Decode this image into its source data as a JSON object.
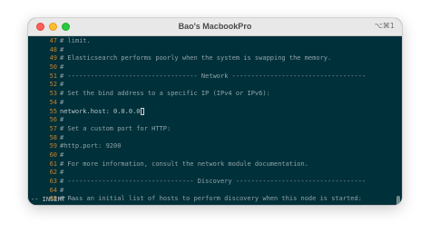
{
  "window": {
    "title": "Bao's MacbookPro",
    "shortcut": "⌥⌘1"
  },
  "editor": {
    "lines": [
      {
        "num": "47",
        "text": "# limit."
      },
      {
        "num": "48",
        "text": "#"
      },
      {
        "num": "49",
        "text": "# Elasticsearch performs poorly when the system is swapping the memory."
      },
      {
        "num": "50",
        "text": "#"
      },
      {
        "num": "51",
        "text": "# ---------------------------------- Network -----------------------------------"
      },
      {
        "num": "52",
        "text": "#"
      },
      {
        "num": "53",
        "text": "# Set the bind address to a specific IP (IPv4 or IPv6):"
      },
      {
        "num": "54",
        "text": "#"
      },
      {
        "num": "55",
        "text": "network.host: 0.0.0.0",
        "cursor": true
      },
      {
        "num": "56",
        "text": "#"
      },
      {
        "num": "57",
        "text": "# Set a custom port for HTTP:"
      },
      {
        "num": "58",
        "text": "#"
      },
      {
        "num": "59",
        "text": "#http.port: 9200"
      },
      {
        "num": "60",
        "text": "#"
      },
      {
        "num": "61",
        "text": "# For more information, consult the network module documentation."
      },
      {
        "num": "62",
        "text": "#"
      },
      {
        "num": "63",
        "text": "# --------------------------------- Discovery ----------------------------------"
      },
      {
        "num": "64",
        "text": "#"
      },
      {
        "num": "65",
        "text": "# Pass an initial list of hosts to perform discovery when this node is started:"
      }
    ],
    "mode": "-- INSERT --"
  },
  "colors": {
    "background": "#00303a",
    "line_number": "#c8802a",
    "text": "#8fa3a8"
  }
}
